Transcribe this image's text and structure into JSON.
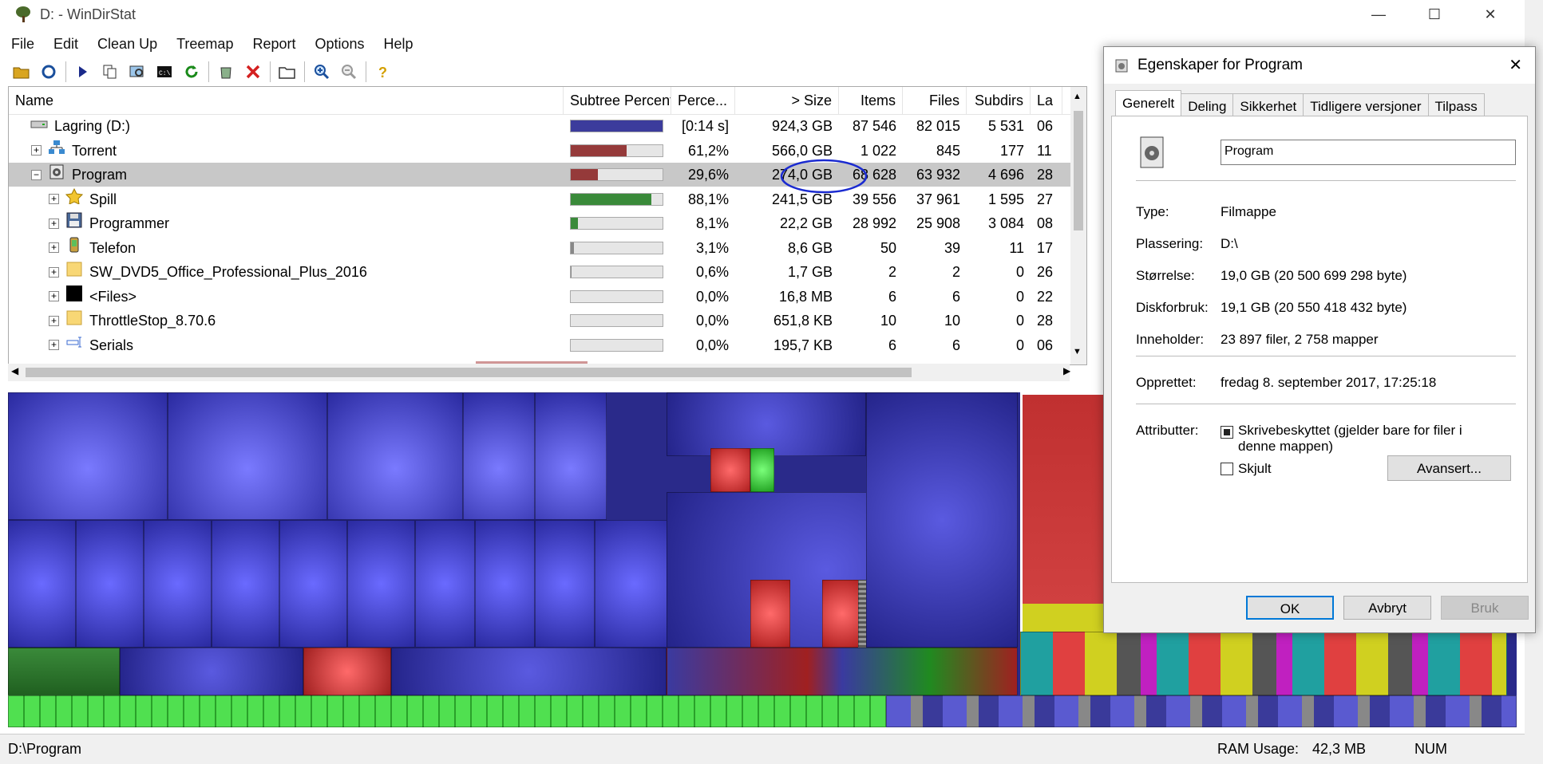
{
  "window": {
    "title": "D: - WinDirStat",
    "minimize": "—",
    "maximize": "☐",
    "close": "✕"
  },
  "menu": [
    "File",
    "Edit",
    "Clean Up",
    "Treemap",
    "Report",
    "Options",
    "Help"
  ],
  "list": {
    "columns": [
      "Name",
      "Subtree Percent...",
      "Perce...",
      "> Size",
      "Items",
      "Files",
      "Subdirs",
      "La"
    ],
    "rows": [
      {
        "name": "Lagring (D:)",
        "icon": "drive-icon",
        "level": 0,
        "expander": "",
        "bar": 1.0,
        "bar_color": "#3c3c9c",
        "percent": "[0:14 s]",
        "size": "924,3 GB",
        "items": "87 546",
        "files": "82 015",
        "subdirs": "5 531",
        "last": "06"
      },
      {
        "name": "Torrent",
        "icon": "network-icon",
        "level": 1,
        "expander": "+",
        "bar": 0.612,
        "bar_color": "#953a3a",
        "percent": "61,2%",
        "size": "566,0 GB",
        "items": "1 022",
        "files": "845",
        "subdirs": "177",
        "last": "11"
      },
      {
        "name": "Program",
        "icon": "program-folder-icon",
        "level": 1,
        "expander": "−",
        "bar": 0.296,
        "bar_color": "#953a3a",
        "percent": "29,6%",
        "size": "274,0 GB",
        "items": "68 628",
        "files": "63 932",
        "subdirs": "4 696",
        "last": "28",
        "selected": true
      },
      {
        "name": "Spill",
        "icon": "star-icon",
        "level": 2,
        "expander": "+",
        "bar": 0.881,
        "bar_color": "#3a8a3a",
        "percent": "88,1%",
        "size": "241,5 GB",
        "items": "39 556",
        "files": "37 961",
        "subdirs": "1 595",
        "last": "27"
      },
      {
        "name": "Programmer",
        "icon": "floppy-icon",
        "level": 2,
        "expander": "+",
        "bar": 0.081,
        "bar_color": "#3a8a3a",
        "percent": "8,1%",
        "size": "22,2 GB",
        "items": "28 992",
        "files": "25 908",
        "subdirs": "3 084",
        "last": "08"
      },
      {
        "name": "Telefon",
        "icon": "phone-icon",
        "level": 2,
        "expander": "+",
        "bar": 0.031,
        "bar_color": "#888",
        "percent": "3,1%",
        "size": "8,6 GB",
        "items": "50",
        "files": "39",
        "subdirs": "11",
        "last": "17"
      },
      {
        "name": "SW_DVD5_Office_Professional_Plus_2016",
        "icon": "folder-icon",
        "level": 2,
        "expander": "+",
        "bar": 0.006,
        "bar_color": "#888",
        "percent": "0,6%",
        "size": "1,7 GB",
        "items": "2",
        "files": "2",
        "subdirs": "0",
        "last": "26"
      },
      {
        "name": "<Files>",
        "icon": "files-icon",
        "level": 2,
        "expander": "+",
        "bar": 0.0,
        "bar_color": "#888",
        "percent": "0,0%",
        "size": "16,8 MB",
        "items": "6",
        "files": "6",
        "subdirs": "0",
        "last": "22"
      },
      {
        "name": "ThrottleStop_8.70.6",
        "icon": "folder-icon",
        "level": 2,
        "expander": "+",
        "bar": 0.0,
        "bar_color": "#888",
        "percent": "0,0%",
        "size": "651,8 KB",
        "items": "10",
        "files": "10",
        "subdirs": "0",
        "last": "28"
      },
      {
        "name": "Serials",
        "icon": "serials-icon",
        "level": 2,
        "expander": "+",
        "bar": 0.0,
        "bar_color": "#888",
        "percent": "0,0%",
        "size": "195,7 KB",
        "items": "6",
        "files": "6",
        "subdirs": "0",
        "last": "06"
      }
    ]
  },
  "status": {
    "path": "D:\\Program",
    "ram_label": "RAM Usage:",
    "ram_value": "42,3 MB",
    "num": "NUM"
  },
  "dialog": {
    "title": "Egenskaper for Program",
    "tabs": [
      "Generelt",
      "Deling",
      "Sikkerhet",
      "Tidligere versjoner",
      "Tilpass"
    ],
    "name_value": "Program",
    "fields": [
      {
        "label": "Type:",
        "value": "Filmappe"
      },
      {
        "label": "Plassering:",
        "value": "D:\\"
      },
      {
        "label": "Størrelse:",
        "value": "19,0 GB (20 500 699 298 byte)"
      },
      {
        "label": "Diskforbruk:",
        "value": "19,1 GB (20 550 418 432 byte)"
      },
      {
        "label": "Inneholder:",
        "value": "23 897 filer, 2 758 mapper"
      }
    ],
    "created_label": "Opprettet:",
    "created_value": "fredag 8. september 2017, 17:25:18",
    "attributes_label": "Attributter:",
    "readonly_label": "Skrivebeskyttet (gjelder bare for filer i denne mappen)",
    "hidden_label": "Skjult",
    "advanced_button": "Avansert...",
    "ok_button": "OK",
    "cancel_button": "Avbryt",
    "apply_button": "Bruk"
  }
}
